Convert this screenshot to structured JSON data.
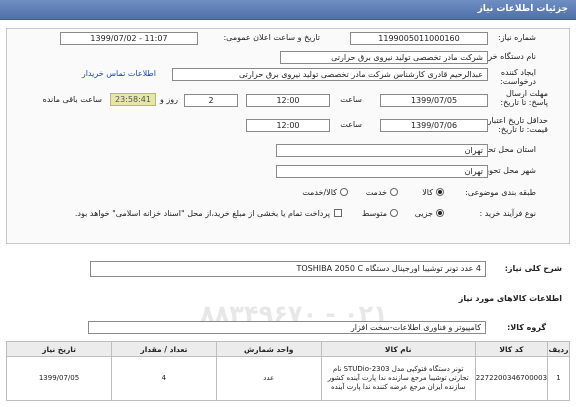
{
  "header": {
    "title": "جزئیات اطلاعات نیاز"
  },
  "form": {
    "need_number_label": "شماره نیاز:",
    "need_number": "1199005011000160",
    "announce_label": "تاریخ و ساعت اعلان عمومی:",
    "announce_value": "1399/07/02 - 11:07",
    "buyer_label": "نام دستگاه خریدار:",
    "buyer_value": "شرکت مادر تخصصی تولید نیروی برق حرارتی",
    "creator_label": "ایجاد کننده درخواست:",
    "creator_value": "عبدالرحیم قادری کارشناس شرکت مادر تخصصی تولید نیروی برق حرارتی",
    "contact_link": "اطلاعات تماس خریدار",
    "deadline_label": "مهلت ارسال پاسخ: تا تاریخ:",
    "deadline_date": "1399/07/05",
    "time_label": "ساعت",
    "deadline_time": "12:00",
    "days_value": "2",
    "days_label": "روز و",
    "timer_value": "23:58:41",
    "remaining_label": "ساعت باقی مانده",
    "price_validity_label": "حداقل تاریخ اعتبار قیمت: تا تاریخ:",
    "price_date": "1399/07/06",
    "price_time": "12:00",
    "province_label": "استان محل تحویل:",
    "province_value": "تهران",
    "city_label": "شهر محل تحویل:",
    "city_value": "تهران",
    "category_label": "طبقه بندی موضوعی:",
    "category_options": [
      "کالا",
      "خدمت",
      "کالا/خدمت"
    ],
    "process_label": "نوع فرآیند خرید :",
    "process_options": [
      "جزیی",
      "متوسط"
    ],
    "payment_note": "پرداخت تمام یا بخشی از مبلغ خرید،از محل \"اسناد خزانه اسلامی\" خواهد بود."
  },
  "summary": {
    "label": "شرح کلی نیاز:",
    "value": "4 عدد تونر توشیبا اورجینال دستگاه TOSHIBA 2050 C"
  },
  "goods": {
    "section_title": "اطلاعات کالاهای مورد نیاز",
    "group_label": "گروه کالا:",
    "group_value": "کامپیوتر و فناوری اطلاعات-سخت افزار",
    "columns": [
      "ردیف",
      "کد کالا",
      "نام کالا",
      "واحد شمارش",
      "تعداد / مقدار",
      "تاریخ نیاز"
    ],
    "rows": [
      {
        "row": "1",
        "code": "2272200346700003",
        "name": "تونر دستگاه فتوکپی مدل STUDio-2303 نام تجارتی توشیبا مرجع سازنده ندا پارت آینده کشور سازنده ایران مرجع عرضه کننده ندا پارت آینده",
        "unit": "عدد",
        "qty": "4",
        "date": "1399/07/05"
      }
    ]
  }
}
